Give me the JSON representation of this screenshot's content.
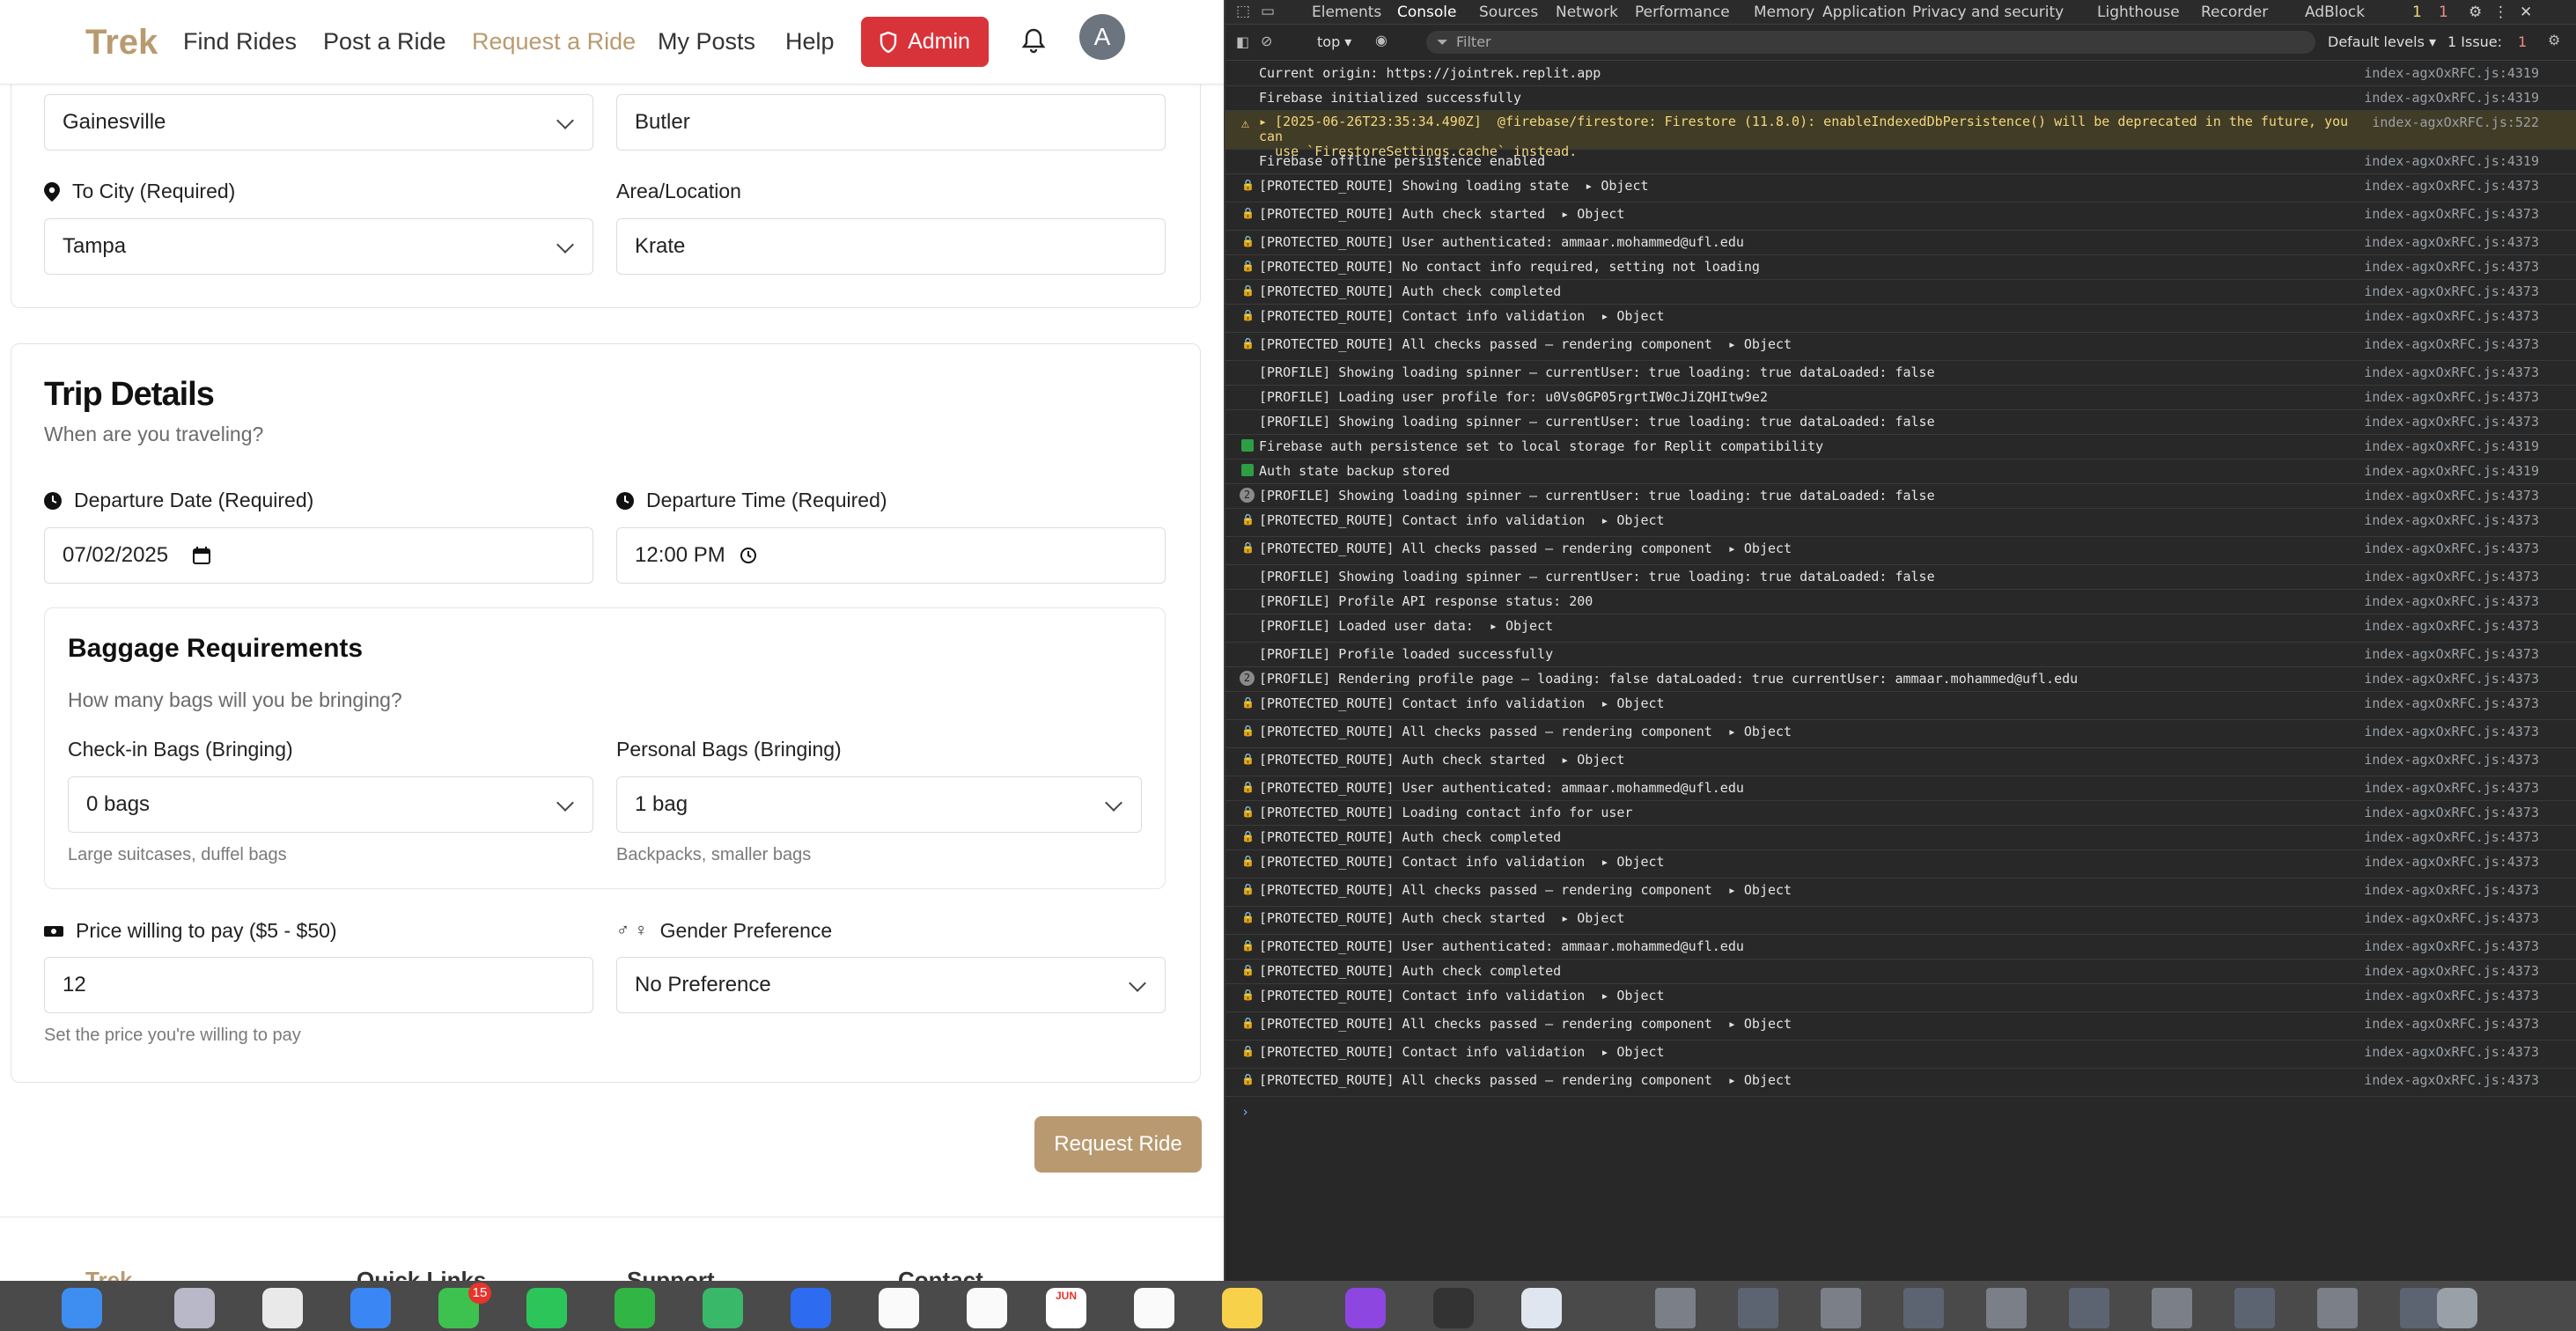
{
  "app": {
    "nav": {
      "logo": "Trek",
      "links": [
        "Find Rides",
        "Post a Ride",
        "Request a Ride",
        "My Posts",
        "Help"
      ],
      "admin_label": "Admin",
      "avatar_initial": "A"
    },
    "route": {
      "from_city_value": "Gainesville",
      "from_area_value": "Butler",
      "to_city_label": "To City (Required)",
      "to_city_value": "Tampa",
      "to_area_label": "Area/Location",
      "to_area_value": "Krate"
    },
    "trip": {
      "title": "Trip Details",
      "subtitle": "When are you traveling?",
      "date_label": "Departure Date (Required)",
      "date_value": "07/02/2025",
      "time_label": "Departure Time (Required)",
      "time_value": "12:00 PM"
    },
    "baggage": {
      "title": "Baggage Requirements",
      "subtitle": "How many bags will you be bringing?",
      "checkin_label": "Check-in Bags (Bringing)",
      "checkin_value": "0 bags",
      "checkin_hint": "Large suitcases, duffel bags",
      "personal_label": "Personal Bags (Bringing)",
      "personal_value": "1 bag",
      "personal_hint": "Backpacks, smaller bags"
    },
    "price": {
      "label": "Price willing to pay ($5 - $50)",
      "value": "12",
      "hint": "Set the price you're willing to pay"
    },
    "gender": {
      "label": "Gender Preference",
      "value": "No Preference"
    },
    "submit_label": "Request Ride",
    "footer": [
      "Trek",
      "Quick Links",
      "Support",
      "Contact"
    ]
  },
  "devtools": {
    "tabs": [
      "Elements",
      "Console",
      "Sources",
      "Network",
      "Performance",
      "Memory",
      "Application",
      "Privacy and security",
      "Lighthouse",
      "Recorder",
      "AdBlock"
    ],
    "active_tab": "Console",
    "context": "top ▾",
    "filter_placeholder": "Filter",
    "levels": "Default levels ▾",
    "issues": "1 Issue:",
    "warn_count": "1",
    "err_count": "1",
    "issue_count": "1",
    "logs": [
      {
        "text": "Current origin: https://jointrek.replit.app",
        "src": "index-agxOxRFC.js:4319",
        "icon": "none"
      },
      {
        "text": "Firebase initialized successfully",
        "src": "index-agxOxRFC.js:4319",
        "icon": "none"
      },
      {
        "text": "▸ [2025-06-26T23:35:34.490Z]  @firebase/firestore: Firestore (11.8.0): enableIndexedDbPersistence() will be deprecated in the future, you can\n  use `FirestoreSettings.cache` instead.",
        "src": "index-agxOxRFC.js:522",
        "icon": "warn"
      },
      {
        "text": "Firebase offline persistence enabled",
        "src": "index-agxOxRFC.js:4319",
        "icon": "none"
      },
      {
        "text": "[PROTECTED_ROUTE] Showing loading state  ▸ Object",
        "src": "index-agxOxRFC.js:4373",
        "icon": "lock"
      },
      {
        "text": "[PROTECTED_ROUTE] Auth check started  ▸ Object",
        "src": "index-agxOxRFC.js:4373",
        "icon": "lock"
      },
      {
        "text": "[PROTECTED_ROUTE] User authenticated: ammaar.mohammed@ufl.edu",
        "src": "index-agxOxRFC.js:4373",
        "icon": "lock"
      },
      {
        "text": "[PROTECTED_ROUTE] No contact info required, setting not loading",
        "src": "index-agxOxRFC.js:4373",
        "icon": "lock"
      },
      {
        "text": "[PROTECTED_ROUTE] Auth check completed",
        "src": "index-agxOxRFC.js:4373",
        "icon": "lock"
      },
      {
        "text": "[PROTECTED_ROUTE] Contact info validation  ▸ Object",
        "src": "index-agxOxRFC.js:4373",
        "icon": "lock"
      },
      {
        "text": "[PROTECTED_ROUTE] All checks passed – rendering component  ▸ Object",
        "src": "index-agxOxRFC.js:4373",
        "icon": "lock"
      },
      {
        "text": "[PROFILE] Showing loading spinner – currentUser: true loading: true dataLoaded: false",
        "src": "index-agxOxRFC.js:4373",
        "icon": "none"
      },
      {
        "text": "[PROFILE] Loading user profile for: u0Vs0GP05rgrtIW0cJiZQHItw9e2",
        "src": "index-agxOxRFC.js:4373",
        "icon": "none"
      },
      {
        "text": "[PROFILE] Showing loading spinner – currentUser: true loading: true dataLoaded: false",
        "src": "index-agxOxRFC.js:4373",
        "icon": "none"
      },
      {
        "text": "Firebase auth persistence set to local storage for Replit compatibility",
        "src": "index-agxOxRFC.js:4319",
        "icon": "check"
      },
      {
        "text": "Auth state backup stored",
        "src": "index-agxOxRFC.js:4319",
        "icon": "check"
      },
      {
        "text": "[PROFILE] Showing loading spinner – currentUser: true loading: true dataLoaded: false",
        "src": "index-agxOxRFC.js:4373",
        "icon": "count",
        "count": "2"
      },
      {
        "text": "[PROTECTED_ROUTE] Contact info validation  ▸ Object",
        "src": "index-agxOxRFC.js:4373",
        "icon": "lock"
      },
      {
        "text": "[PROTECTED_ROUTE] All checks passed – rendering component  ▸ Object",
        "src": "index-agxOxRFC.js:4373",
        "icon": "lock"
      },
      {
        "text": "[PROFILE] Showing loading spinner – currentUser: true loading: true dataLoaded: false",
        "src": "index-agxOxRFC.js:4373",
        "icon": "none"
      },
      {
        "text": "[PROFILE] Profile API response status: 200",
        "src": "index-agxOxRFC.js:4373",
        "icon": "none"
      },
      {
        "text": "[PROFILE] Loaded user data:  ▸ Object",
        "src": "index-agxOxRFC.js:4373",
        "icon": "none"
      },
      {
        "text": "[PROFILE] Profile loaded successfully",
        "src": "index-agxOxRFC.js:4373",
        "icon": "none"
      },
      {
        "text": "[PROFILE] Rendering profile page – loading: false dataLoaded: true currentUser: ammaar.mohammed@ufl.edu",
        "src": "index-agxOxRFC.js:4373",
        "icon": "count",
        "count": "2"
      },
      {
        "text": "[PROTECTED_ROUTE] Contact info validation  ▸ Object",
        "src": "index-agxOxRFC.js:4373",
        "icon": "lock"
      },
      {
        "text": "[PROTECTED_ROUTE] All checks passed – rendering component  ▸ Object",
        "src": "index-agxOxRFC.js:4373",
        "icon": "lock"
      },
      {
        "text": "[PROTECTED_ROUTE] Auth check started  ▸ Object",
        "src": "index-agxOxRFC.js:4373",
        "icon": "lock"
      },
      {
        "text": "[PROTECTED_ROUTE] User authenticated: ammaar.mohammed@ufl.edu",
        "src": "index-agxOxRFC.js:4373",
        "icon": "lock"
      },
      {
        "text": "[PROTECTED_ROUTE] Loading contact info for user",
        "src": "index-agxOxRFC.js:4373",
        "icon": "lock"
      },
      {
        "text": "[PROTECTED_ROUTE] Auth check completed",
        "src": "index-agxOxRFC.js:4373",
        "icon": "lock"
      },
      {
        "text": "[PROTECTED_ROUTE] Contact info validation  ▸ Object",
        "src": "index-agxOxRFC.js:4373",
        "icon": "lock"
      },
      {
        "text": "[PROTECTED_ROUTE] All checks passed – rendering component  ▸ Object",
        "src": "index-agxOxRFC.js:4373",
        "icon": "lock"
      },
      {
        "text": "[PROTECTED_ROUTE] Auth check started  ▸ Object",
        "src": "index-agxOxRFC.js:4373",
        "icon": "lock"
      },
      {
        "text": "[PROTECTED_ROUTE] User authenticated: ammaar.mohammed@ufl.edu",
        "src": "index-agxOxRFC.js:4373",
        "icon": "lock"
      },
      {
        "text": "[PROTECTED_ROUTE] Auth check completed",
        "src": "index-agxOxRFC.js:4373",
        "icon": "lock"
      },
      {
        "text": "[PROTECTED_ROUTE] Contact info validation  ▸ Object",
        "src": "index-agxOxRFC.js:4373",
        "icon": "lock"
      },
      {
        "text": "[PROTECTED_ROUTE] All checks passed – rendering component  ▸ Object",
        "src": "index-agxOxRFC.js:4373",
        "icon": "lock"
      },
      {
        "text": "[PROTECTED_ROUTE] Contact info validation  ▸ Object",
        "src": "index-agxOxRFC.js:4373",
        "icon": "lock"
      },
      {
        "text": "[PROTECTED_ROUTE] All checks passed – rendering component  ▸ Object",
        "src": "index-agxOxRFC.js:4373",
        "icon": "lock"
      }
    ],
    "prompt": "›"
  },
  "dock": {
    "messages_badge": "15",
    "calendar_month": "JUN"
  },
  "colors": {
    "brand": "#b99a70",
    "admin": "#d9333a",
    "devtools_bg": "#282828"
  }
}
